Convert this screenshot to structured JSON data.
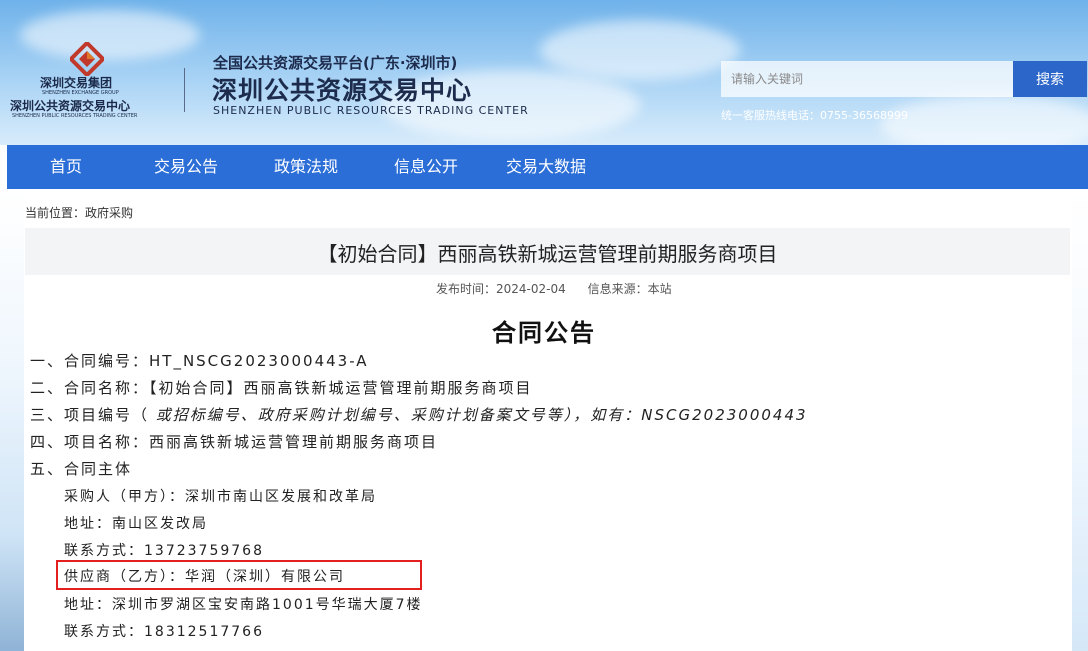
{
  "header": {
    "logo": {
      "group_cn": "深圳交易集团",
      "group_en": "SHENZHEN EXCHANGE GROUP",
      "center_cn": "深圳公共资源交易中心",
      "center_en": "SHENZHEN PUBLIC RESOURCES TRADING CENTER"
    },
    "platform_sub": "全国公共资源交易平台(广东·深圳市)",
    "platform_title": "深圳公共资源交易中心",
    "platform_en": "SHENZHEN PUBLIC RESOURCES TRADING CENTER",
    "search": {
      "placeholder": "请输入关键词",
      "button": "搜索"
    },
    "hotline": "统一客服热线电话：0755-36568999"
  },
  "nav": {
    "items": [
      {
        "label": "首页"
      },
      {
        "label": "交易公告"
      },
      {
        "label": "政策法规"
      },
      {
        "label": "信息公开"
      },
      {
        "label": "交易大数据"
      }
    ]
  },
  "breadcrumb": "当前位置：政府采购",
  "article": {
    "title": "【初始合同】西丽高铁新城运营管理前期服务商项目",
    "publish_time": "发布时间：2024-02-04",
    "source": "信息来源：本站",
    "heading": "合同公告",
    "lines": {
      "contract_no": "一、合同编号：HT_NSCG2023000443-A",
      "contract_name": "二、合同名称：【初始合同】西丽高铁新城运营管理前期服务商项目",
      "project_no_prefix": "三、项目编号（",
      "project_no_note": " 或招标编号、政府采购计划编号、采购计划备案文号等），如有：NSCG2023000443",
      "project_name": "四、项目名称：西丽高铁新城运营管理前期服务商项目",
      "parties": "五、合同主体",
      "buyer": "采购人（甲方）：深圳市南山区发展和改革局",
      "buyer_address": "地址：南山区发改局",
      "buyer_contact": "联系方式：13723759768",
      "supplier": "供应商（乙方）：华润（深圳）有限公司",
      "supplier_address": "地址：深圳市罗湖区宝安南路1001号华瑞大厦7楼",
      "supplier_contact": "联系方式：18312517766"
    }
  },
  "colors": {
    "nav_bg": "#2b6ed7",
    "search_button": "#2c66c9",
    "highlight": "#e41f1f"
  },
  "icons": [
    "logo-mark-icon"
  ]
}
